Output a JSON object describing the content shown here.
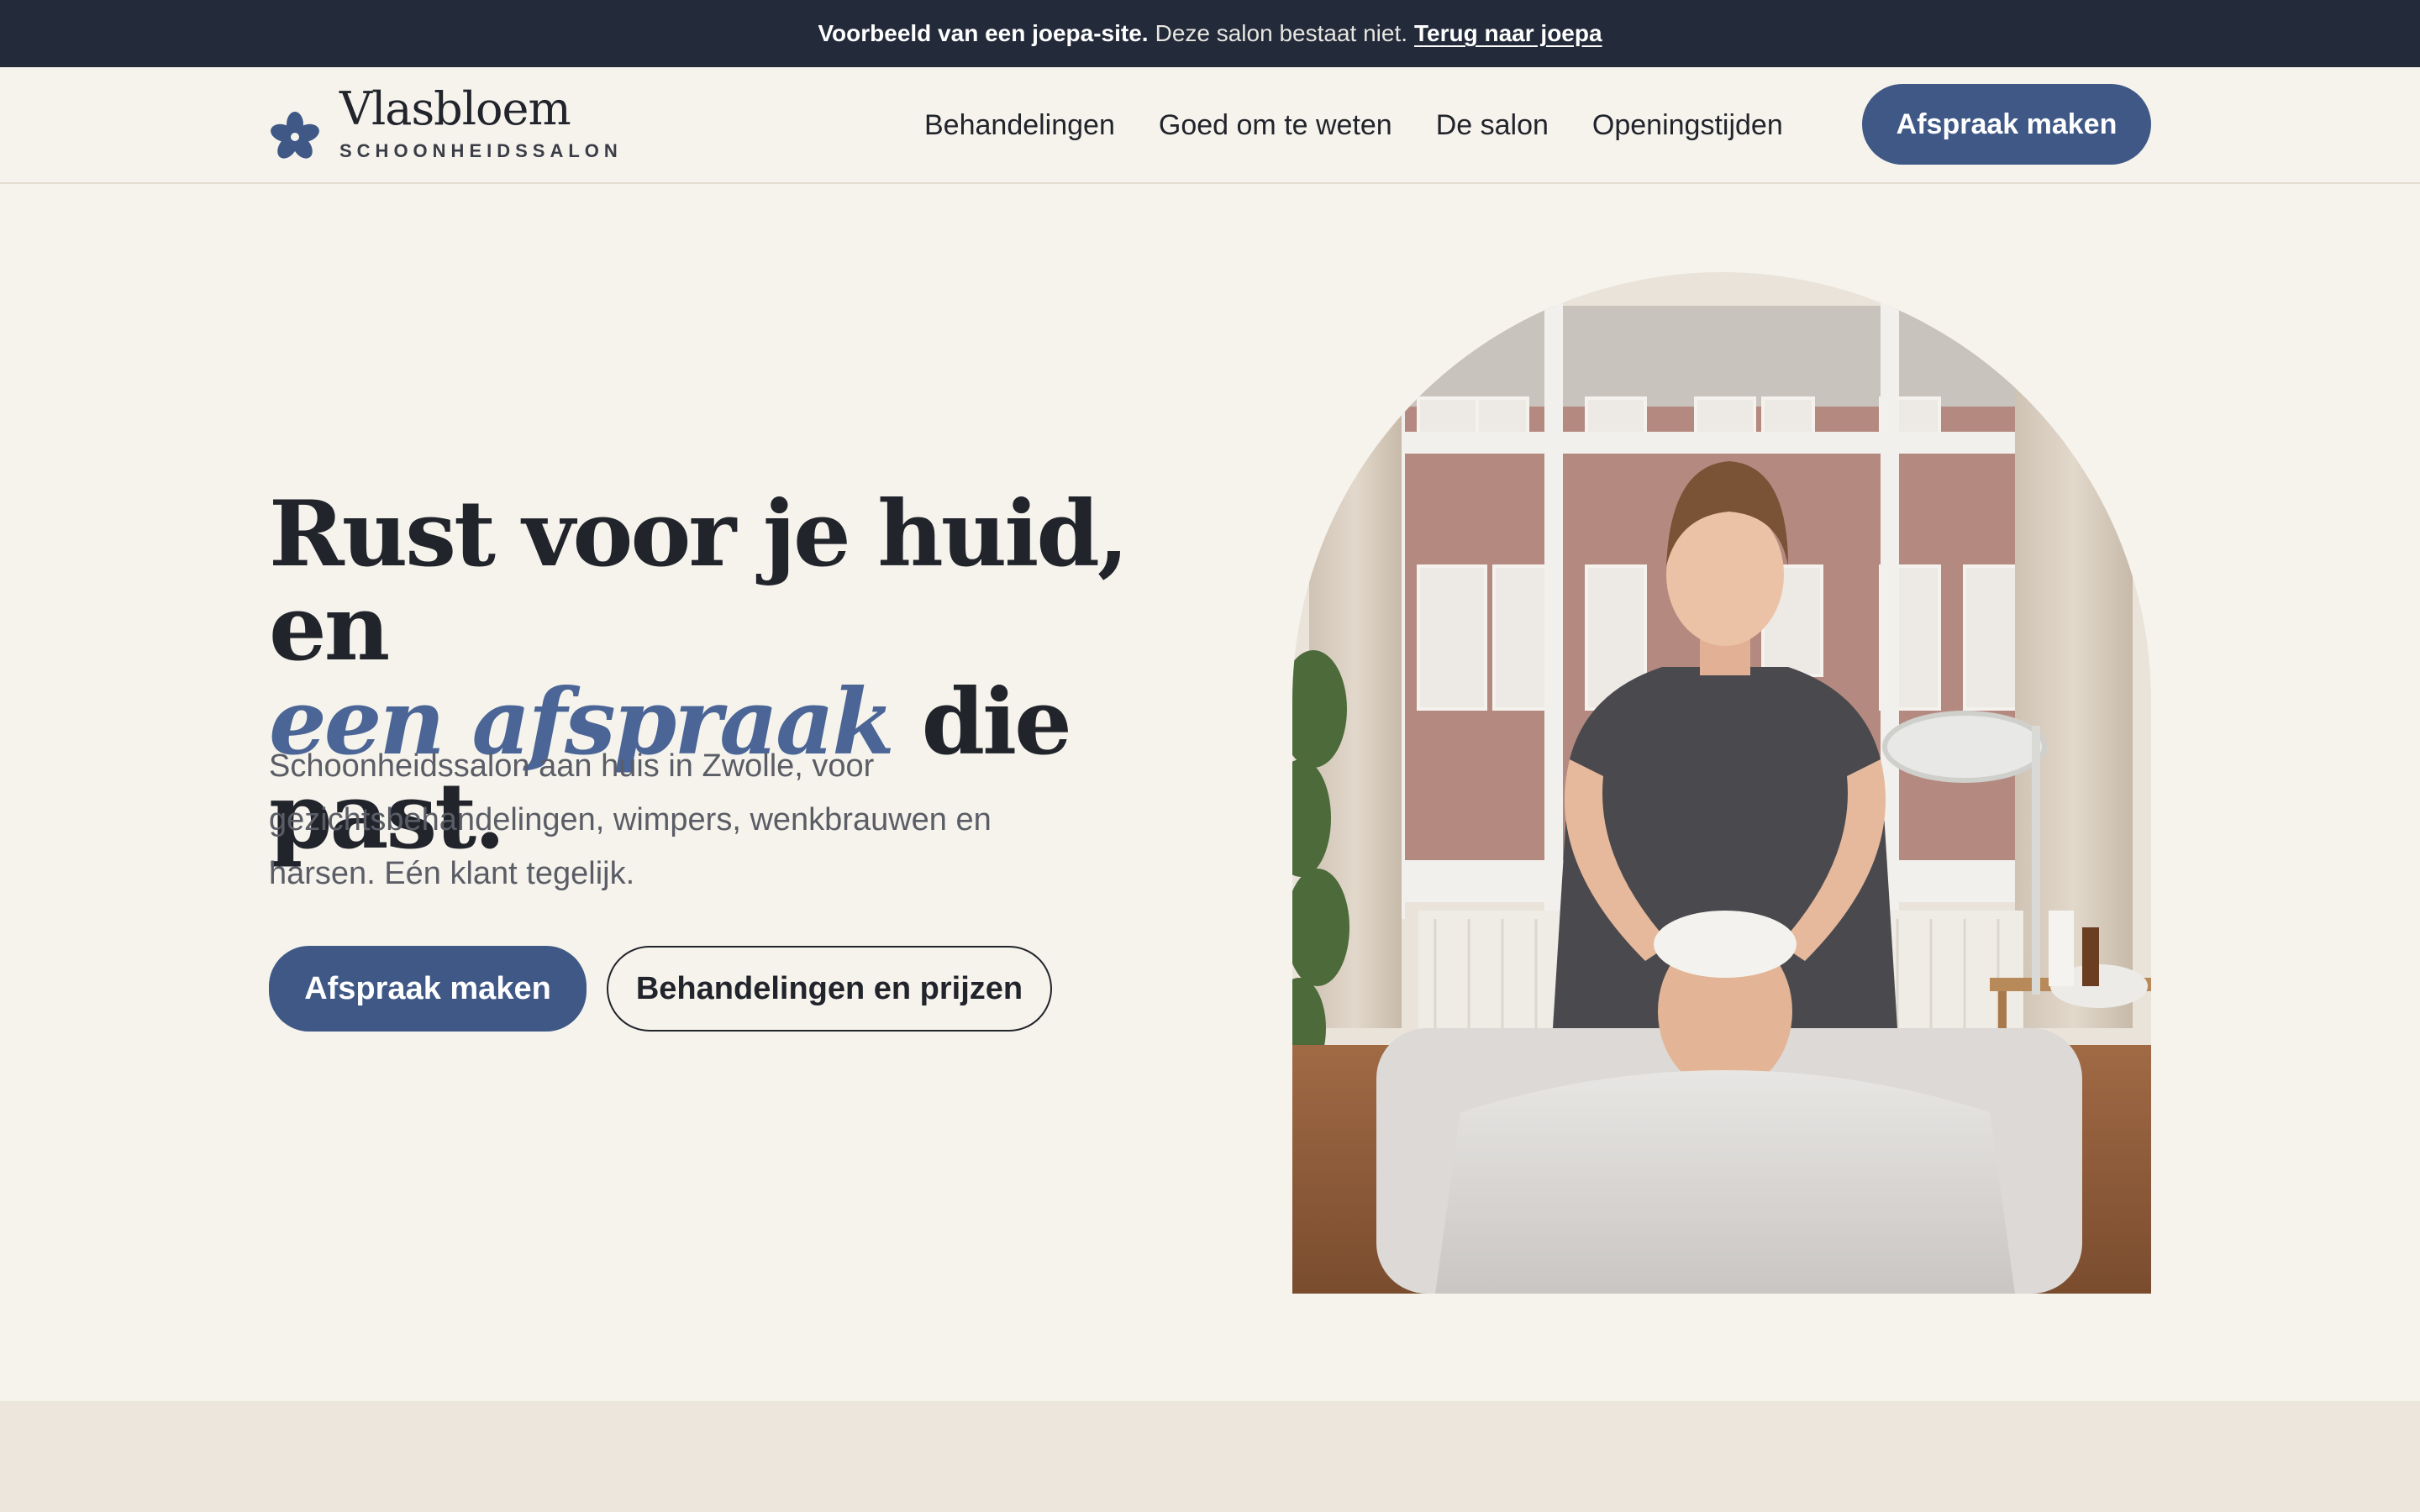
{
  "notice": {
    "bold_text": "Voorbeeld van een joepa-site.",
    "text": "Deze salon bestaat niet.",
    "link_label": "Terug naar joepa"
  },
  "brand": {
    "name": "Vlasbloem",
    "subtitle": "SCHOONHEIDSSALON",
    "icon": "flax-flower-icon",
    "accent_color": "#3f5886"
  },
  "nav": {
    "items": [
      {
        "label": "Behandelingen"
      },
      {
        "label": "Goed om te weten"
      },
      {
        "label": "De salon"
      },
      {
        "label": "Openingstijden"
      }
    ],
    "cta_label": "Afspraak maken"
  },
  "hero": {
    "title_line1": "Rust voor je huid, en",
    "title_accent": "een afspraak",
    "title_rest": " die past.",
    "description": "Schoonheidssalon aan huis in Zwolle, voor gezichtsbehandelingen, wimpers, wenkbrauwen en harsen. Eén klant tegelijk.",
    "primary_button": "Afspraak maken",
    "secondary_button": "Behandelingen en prijzen",
    "image_alt_icon": "facial-treatment-photo"
  }
}
